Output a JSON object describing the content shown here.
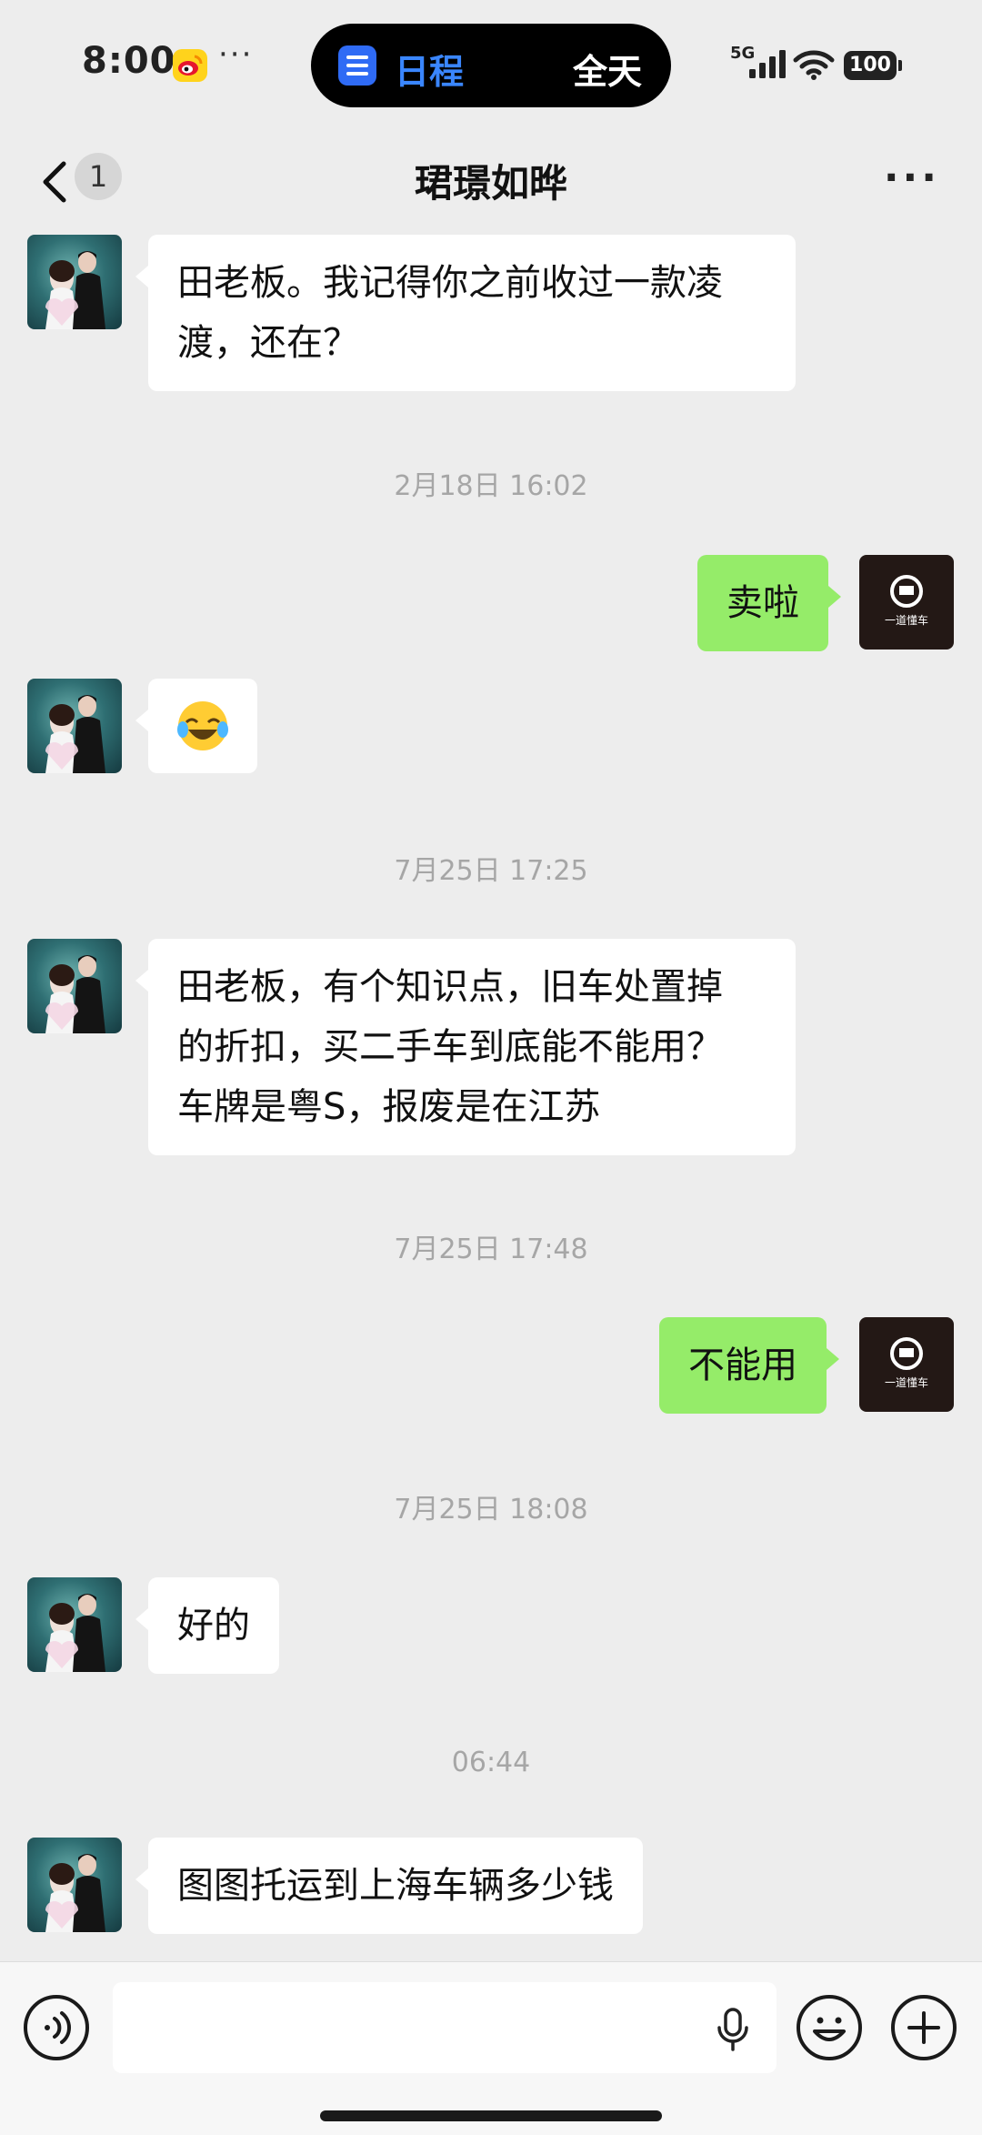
{
  "status_bar": {
    "time": "8:00",
    "more_dots": "···",
    "island_title": "日程",
    "island_right": "全天",
    "network": "5G",
    "battery": "100"
  },
  "nav": {
    "back_count": "1",
    "title": "珺璟如晔",
    "more": "···"
  },
  "messages": [
    {
      "from": "them",
      "text": "田老板。我记得你之前收过一款凌\n渡，还在？"
    },
    {
      "timestamp": "2月18日 16:02"
    },
    {
      "from": "me",
      "text": "卖啦"
    },
    {
      "from": "them",
      "emoji": "😂"
    },
    {
      "timestamp": "7月25日 17:25"
    },
    {
      "from": "them",
      "text": "田老板，有个知识点，旧车处置掉\n的折扣，买二手车到底能不能用？\n车牌是粤S，报废是在江苏"
    },
    {
      "timestamp": "7月25日 17:48"
    },
    {
      "from": "me",
      "text": "不能用"
    },
    {
      "timestamp": "7月25日 18:08"
    },
    {
      "from": "them",
      "text": "好的"
    },
    {
      "timestamp": "06:44"
    },
    {
      "from": "them",
      "text": "图图托运到上海车辆多少钱"
    }
  ],
  "my_avatar_text": "一道懂车",
  "icons": {
    "weibo": "weibo-icon",
    "calendar": "calendar-icon",
    "signal": "signal-icon",
    "wifi": "wifi-icon",
    "back": "chevron-left-icon",
    "voice": "voice-icon",
    "mic": "mic-icon",
    "emoji": "emoji-icon",
    "plus": "plus-icon"
  },
  "colors": {
    "background": "#ededed",
    "my_bubble": "#95ec69",
    "their_bubble": "#ffffff",
    "island_accent": "#3a86ff"
  }
}
